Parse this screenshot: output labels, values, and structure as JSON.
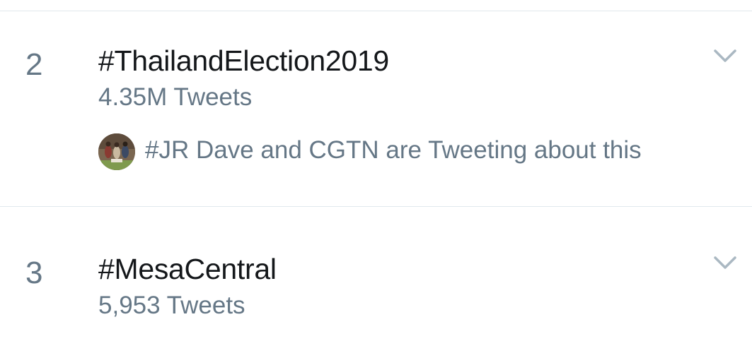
{
  "trends": [
    {
      "rank": "2",
      "title": "#ThailandElection2019",
      "count": "4.35M Tweets",
      "context": "#JR Dave and CGTN are Tweeting about this"
    },
    {
      "rank": "3",
      "title": "#MesaCentral",
      "count": "5,953 Tweets"
    }
  ],
  "icons": {
    "more": "chevron-down-icon",
    "avatar": "avatar"
  },
  "colors": {
    "primary_text": "#14171a",
    "secondary_text": "#657786",
    "divider": "#e1e8ed",
    "chevron": "#aab8c2"
  }
}
